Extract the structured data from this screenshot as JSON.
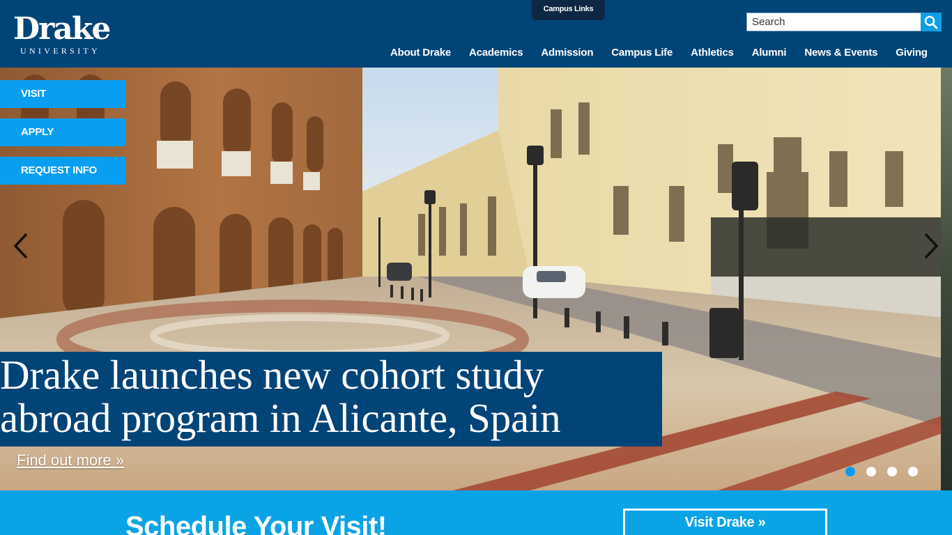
{
  "logo": {
    "wordmark": "Drake",
    "subtitle": "UNIVERSITY"
  },
  "campus_links_label": "Campus Links",
  "search": {
    "placeholder": "Search",
    "icon": "search-icon"
  },
  "nav": {
    "items": [
      {
        "label": "About Drake"
      },
      {
        "label": "Academics"
      },
      {
        "label": "Admission"
      },
      {
        "label": "Campus Life"
      },
      {
        "label": "Athletics"
      },
      {
        "label": "Alumni"
      },
      {
        "label": "News & Events"
      },
      {
        "label": "Giving"
      }
    ]
  },
  "cta": {
    "visit": "VISIT",
    "apply": "APPLY",
    "request_info": "REQUEST INFO"
  },
  "hero": {
    "headline_line1": "Drake launches new cohort study",
    "headline_line2": "abroad program in Alicante, Spain",
    "link": "Find out more »",
    "prev_icon": "chevron-left-icon",
    "next_icon": "chevron-right-icon",
    "slide_count": 4,
    "active_slide": 1
  },
  "schedule": {
    "title": "Schedule Your Visit!",
    "button": "Visit Drake »"
  },
  "colors": {
    "header_bg": "#004478",
    "accent_blue": "#0a9ef0",
    "campus_links_bg": "#0e2744",
    "band_bg": "#0aa4e6"
  }
}
